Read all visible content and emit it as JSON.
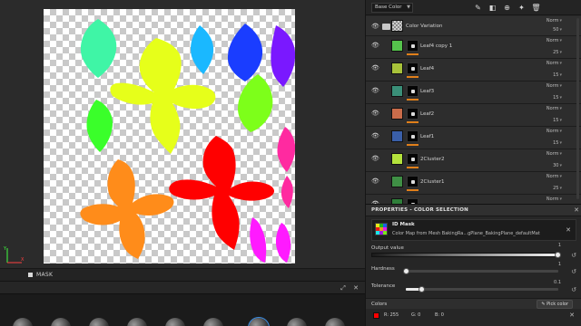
{
  "viewport": {
    "mask_label": "MASK",
    "axis": {
      "x_color": "#ff4040",
      "y_color": "#40ff40"
    },
    "shelf_items": 7,
    "icons": [
      "expand-icon",
      "close-icon"
    ]
  },
  "layers": {
    "channel": "Base Color",
    "toolbar_icons": [
      "paint-brush-icon",
      "fill-icon",
      "add-layer-icon",
      "effects-icon",
      "delete-icon"
    ],
    "rows": [
      {
        "name": "Color Variation",
        "kind": "folder",
        "blend": "Norm",
        "opacity": "50",
        "color": "#c9c9c9"
      },
      {
        "name": "Leaf4 copy 1",
        "kind": "fill",
        "blend": "Norm",
        "opacity": "25",
        "color": "#55c34c"
      },
      {
        "name": "Leaf4",
        "kind": "fill",
        "blend": "Norm",
        "opacity": "15",
        "color": "#a8c23a"
      },
      {
        "name": "Leaf3",
        "kind": "fill",
        "blend": "Norm",
        "opacity": "15",
        "color": "#3a8f78"
      },
      {
        "name": "Leaf2",
        "kind": "fill",
        "blend": "Norm",
        "opacity": "15",
        "color": "#c96c4a"
      },
      {
        "name": "Leaf1",
        "kind": "fill",
        "blend": "Norm",
        "opacity": "15",
        "color": "#3a5fa8"
      },
      {
        "name": "2Cluster2",
        "kind": "fill",
        "blend": "Norm",
        "opacity": "30",
        "color": "#b4e23c"
      },
      {
        "name": "2Cluster1",
        "kind": "fill",
        "blend": "Norm",
        "opacity": "25",
        "color": "#3f8f45"
      },
      {
        "name": "",
        "kind": "fill",
        "blend": "Norm",
        "opacity": "",
        "color": "#2f7f3a"
      }
    ]
  },
  "properties": {
    "title": "PROPERTIES - COLOR SELECTION",
    "filter_name": "ID Mask",
    "filter_source": "Color Map from Mesh BakingRa...gPlane_BakingPlane_defaultMat",
    "output_label": "Output value",
    "output_max": "1",
    "output_value": 1.0,
    "hardness_label": "Hardness",
    "hardness_max": "1",
    "hardness_value": 0.0,
    "tolerance_label": "Tolerance",
    "tolerance_max": "0.1",
    "tolerance_value": 0.01,
    "colors_label": "Colors",
    "pick_color_label": "Pick color",
    "color": {
      "hex": "#ff0000",
      "r_label": "R: 255",
      "g_label": "G: 0",
      "b_label": "B: 0"
    }
  }
}
